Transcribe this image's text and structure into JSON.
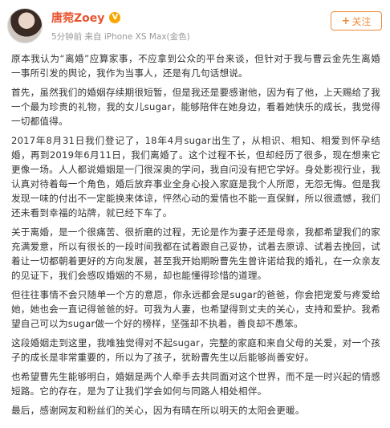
{
  "post": {
    "author": "唐菀Zoey",
    "verified_badge": "V",
    "meta": "5分钟前 来自 iPhone XS Max(金色)",
    "follow_label": "关注",
    "follow_icon": "+",
    "paragraphs": [
      "原本我认为“离婚”应算家事，不应拿到公众的平台来谈，但针对于我与曹云金先生离婚一事所引发的舆论，我作为当事人，还是有几句话想说。",
      "首先，虽然我们的婚姻存续期很短暂，但是我还是要感谢他，因为有了他，上天赐给了我一个最为珍贵的礼物，我的女儿sugar，能够陪伴在她身边，看着她快乐的成长，我觉得一切都值得。",
      "2017年8月31日我们登记了，18年4月sugar出生了，从相识、相知、相爱到怀孕结婚，再到2019年6月11日，我们离婚了。这个过程不长，但却经历了很多，现在想来它更像一场。人人都说婚姻是一门很深奥的学问，我自问没有把它学好。身处影视行业，我认真对待着每一个角色，婚后放弃事业全身心投入家庭是我个人所愿，无怨无悔。但是我发现一味的付出不一定能换来体谅，怦然心动的爱情也不能一直保鲜，所以很遗憾，我们还未看到幸福的站牌，就已经下车了。",
      "关于离婚，是一个很痛苦、很折磨的过程，无论是作为妻子还是母亲，我都希望我们的家充满爱意，所以有很长的一段时间我都在试着跟自己妥协，试着去原谅、试着去挽回，试着让一切都朝着更好的方向发展，甚至我开始期盼曹先生曾许诺给我的婚礼，在一众亲友的见证下，我们会感叹婚姻的不易，却也能懂得珍惜的道理。",
      "但往往事情不会只随单一个方的意愿，你永远都会是sugar的爸爸，你会把宠爱与疼爱给她，她也会一直记得爸爸的好。可我为人妻，也希望得到丈夫的关心，支持和爱护。我希望自己可以为sugar做一个好的榜样，坚强却不执着，善良却不愚笨。",
      "这段婚姻走到这里，我唯独觉得对不起sugar，完整的家庭和来自父母的关爱，对一个孩子的成长是非常重要的，所以为了孩子，犹盼曹先生以后能够尚善安好。",
      "也希望曹先生能够明白，婚姻是两个人牵手去共同面对这个世界，而不是一时兴起的情感短路。它的存在，是为了让我们学会如何与同路人相处相伴。",
      "最后，感谢网友和粉丝们的关心，因为有晴在所以明天的太阳会更暖。"
    ]
  }
}
